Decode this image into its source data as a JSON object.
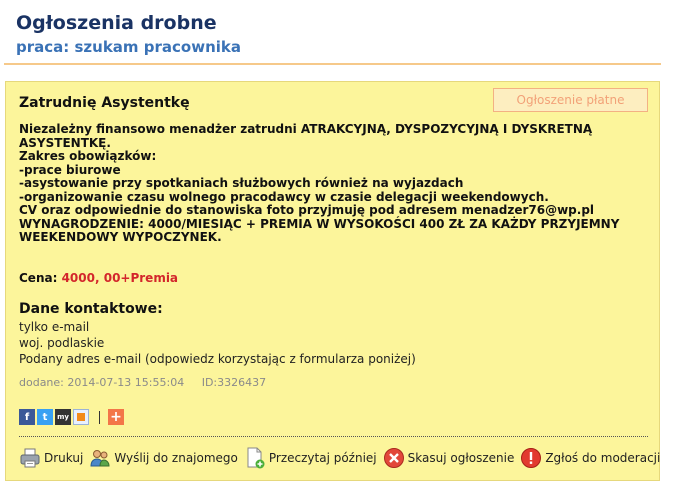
{
  "header": {
    "title": "Ogłoszenia drobne",
    "subtitle": "praca: szukam pracownika"
  },
  "ad": {
    "title": "Zatrudnię Asystentkę",
    "badge": "Ogłoszenie płatne",
    "description": [
      "Niezależny finansowo menadżer zatrudni ATRAKCYJNĄ, DYSPOZYCYJNĄ I DYSKRETNĄ",
      "ASYSTENTKĘ.",
      "Zakres obowiązków:",
      "-prace biurowe",
      "-asystowanie przy spotkaniach służbowych również na wyjazdach",
      "-organizowanie czasu wolnego pracodawcy w czasie delegacji weekendowych.",
      "CV oraz odpowiednie do stanowiska foto przyjmuję pod adresem menadzer76@wp.pl",
      "WYNAGRODZENIE: 4000/MIESIĄC + PREMIA W WYSOKOŚCI 400 ZŁ ZA KAŻDY PRZYJEMNY",
      "WEEKENDOWY WYPOCZYNEK."
    ],
    "price_label": "Cena:",
    "price_value": "4000, 00+Premia",
    "contact_heading": "Dane kontaktowe:",
    "contact_lines": [
      "tylko e-mail",
      "woj. podlaskie",
      "Podany adres e-mail (odpowiedz korzystając z formularza poniżej)"
    ],
    "added": "dodane: 2014-07-13 15:55:04",
    "id": "ID:3326437"
  },
  "social": {
    "facebook": "f",
    "twitter": "t",
    "myspace": "my",
    "plus": "+"
  },
  "actions": {
    "print": "Drukuj",
    "send": "Wyślij do znajomego",
    "read_later": "Przeczytaj później",
    "delete": "Skasuj ogłoszenie",
    "report": "Zgłoś do moderacji"
  }
}
